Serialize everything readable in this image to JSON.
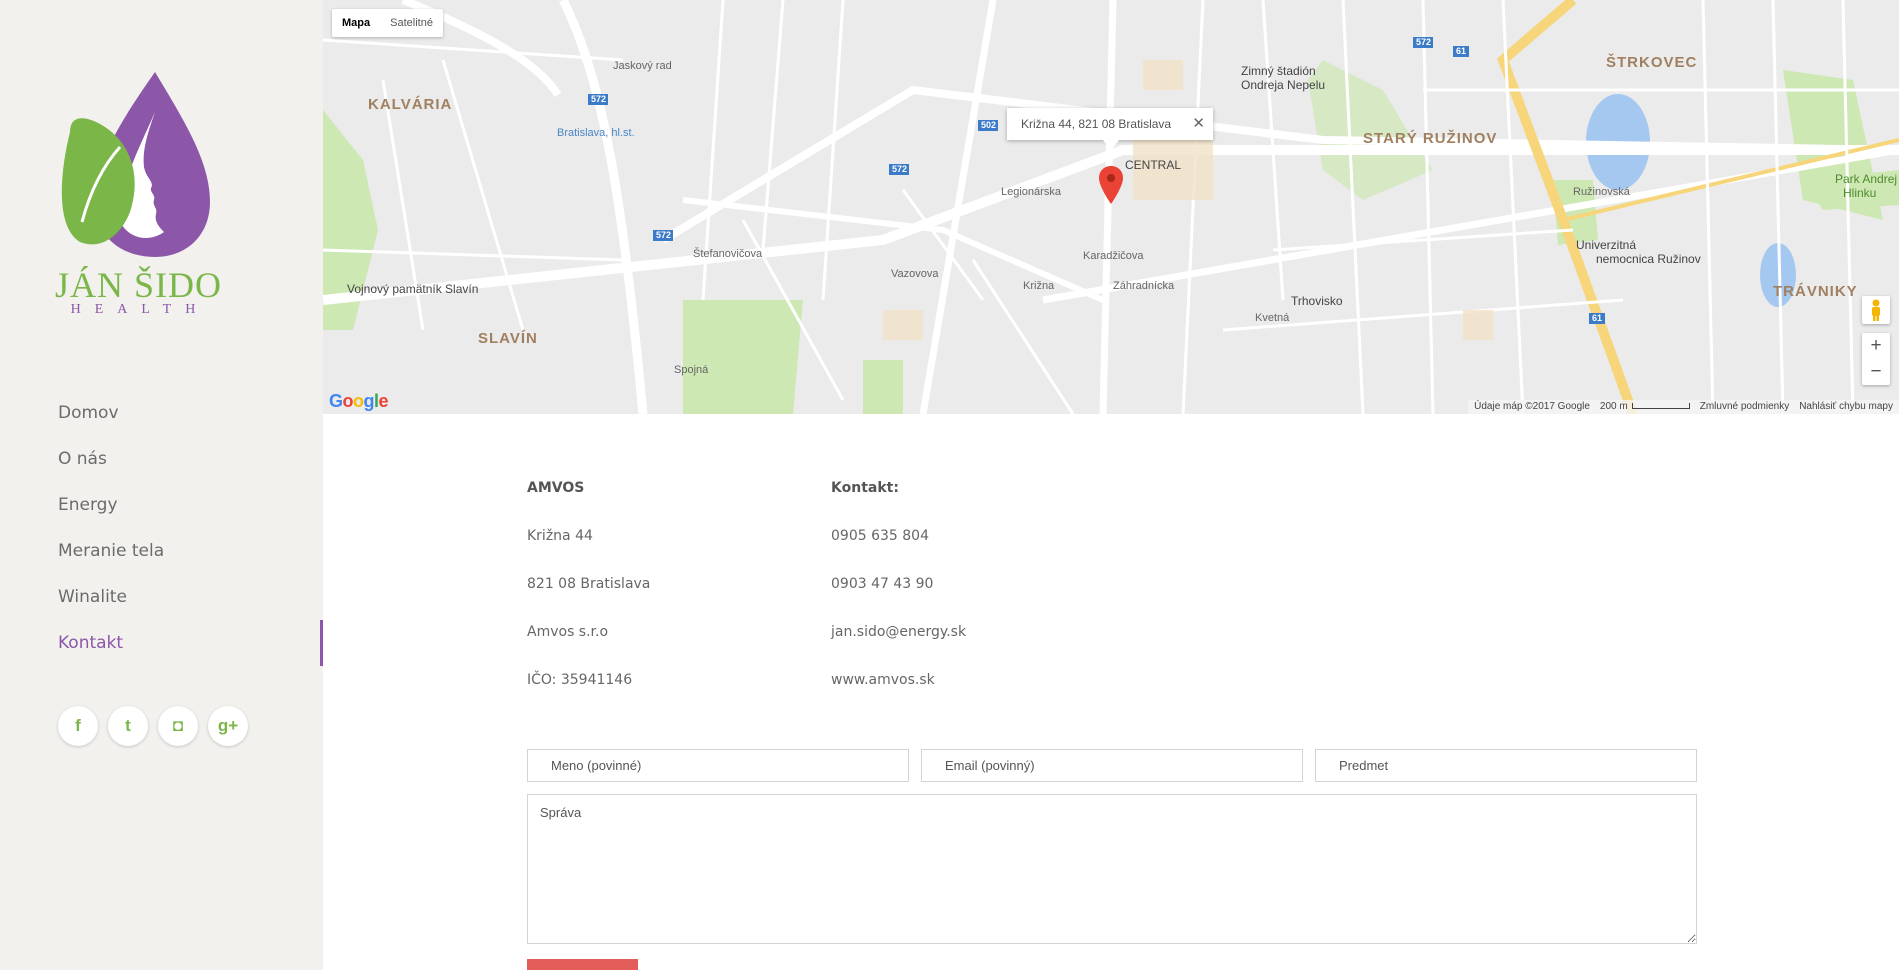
{
  "brand": {
    "name": "JÁN ŠIDO",
    "tagline": "HEALTH",
    "green": "#7ab648",
    "purple": "#8c57a8"
  },
  "nav": {
    "items": [
      {
        "label": "Domov"
      },
      {
        "label": "O nás"
      },
      {
        "label": "Energy"
      },
      {
        "label": "Meranie tela"
      },
      {
        "label": "Winalite"
      },
      {
        "label": "Kontakt",
        "active": true
      }
    ]
  },
  "social": [
    {
      "icon": "facebook-icon",
      "glyph": "f"
    },
    {
      "icon": "twitter-icon",
      "glyph": "t"
    },
    {
      "icon": "instagram-icon",
      "glyph": "◘"
    },
    {
      "icon": "google-plus-icon",
      "glyph": "g+"
    }
  ],
  "map": {
    "type_buttons": [
      "Mapa",
      "Satelitné"
    ],
    "infowindow": "Križna 44, 821 08 Bratislava",
    "labels": {
      "kalvaria": "KALVÁRIA",
      "slavin": "SLAVÍN",
      "strkovec": "ŠTRKOVEC",
      "stary_ruzinov": "STARÝ RUŽINOV",
      "travniky": "TRÁVNIKY",
      "central": "CENTRAL",
      "zimny_stadion": "Zimný štadión",
      "zimny_stadion_2": "Ondreja Nepelu",
      "trhovisko": "Trhovisko",
      "univerzitna": "Univerzitná",
      "univerzitna_2": "nemocnica Ružinov",
      "slavin_pamatnik": "Vojnový pamätník Slavín",
      "park": "Park Andrej",
      "park_2": "Hlinku",
      "bratislava_hl_st": "Bratislava, hl.st.",
      "stefanovicova": "Štefanovičova",
      "ruzinovska": "Ružinovská",
      "legionarska": "Legionárska",
      "karadzicova": "Karadžičova",
      "jaskovy_rad": "Jaskový rad",
      "vazovova": "Vazovova",
      "krizna": "Križna",
      "zahradnicka": "Záhradnícka",
      "kvetna": "Kvetná",
      "spojna": "Spojná"
    },
    "road_shields": [
      "572",
      "572",
      "572",
      "502",
      "572",
      "61",
      "61"
    ],
    "google": "Google",
    "attribution": {
      "data": "Údaje máp ©2017 Google",
      "scale": "200 m",
      "terms": "Zmluvné podmienky",
      "report": "Nahlásiť chybu mapy"
    }
  },
  "contact": {
    "left": [
      "AMVOS",
      "Križna 44",
      "821 08 Bratislava",
      "Amvos s.r.o",
      "IČO: 35941146"
    ],
    "right": [
      "Kontakt:",
      "0905 635 804",
      "0903 47 43 90",
      "jan.sido@energy.sk",
      "www.amvos.sk"
    ]
  },
  "form": {
    "name_placeholder": "Meno (povinné)",
    "email_placeholder": "Email (povinný)",
    "subject_placeholder": "Predmet",
    "message_placeholder": "Správa",
    "submit_color": "#e35d5b"
  }
}
